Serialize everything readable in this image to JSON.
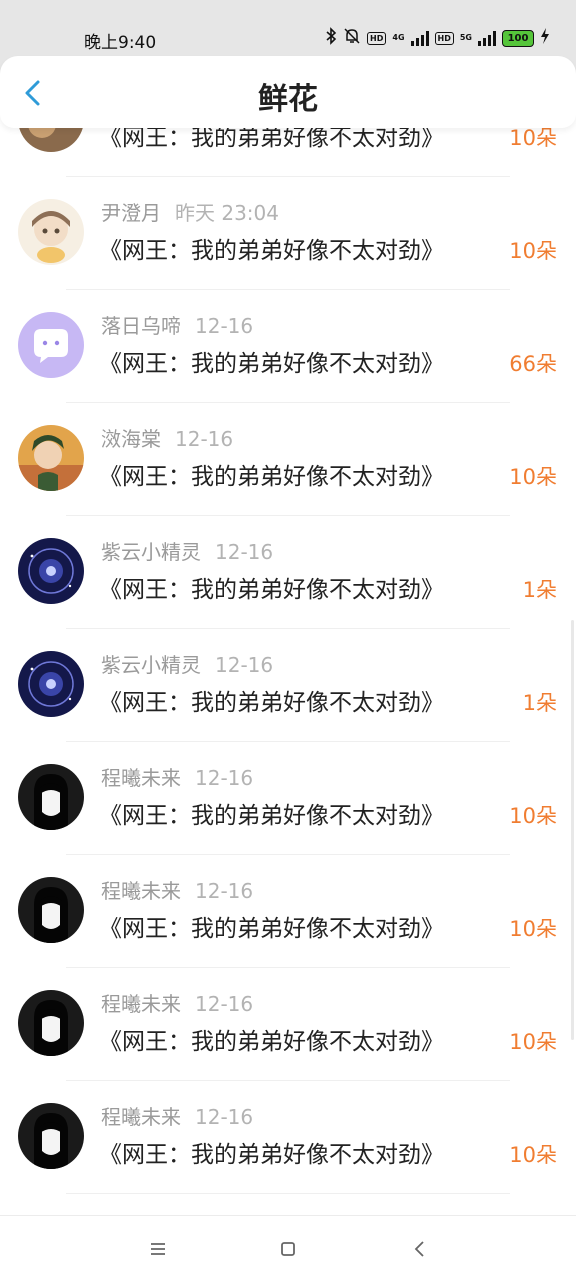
{
  "status_bar": {
    "time": "晚上9:40",
    "hd1": "HD",
    "net1": "4G",
    "hd2": "HD",
    "net2": "5G",
    "battery": "100",
    "icons": [
      "bluetooth-icon",
      "mute-icon",
      "signal-icon",
      "battery-icon",
      "charging-icon"
    ]
  },
  "header": {
    "title": "鲜花",
    "back_icon": "chevron-left-icon"
  },
  "items": [
    {
      "name": "",
      "date": "",
      "book": "《网王：我的弟弟好像不太对劲》",
      "count": "10朵",
      "avatar": "photo"
    },
    {
      "name": "尹澄月",
      "date": "昨天 23:04",
      "book": "《网王：我的弟弟好像不太对劲》",
      "count": "10朵",
      "avatar": "anime-girl"
    },
    {
      "name": "落日乌啼",
      "date": "12-16",
      "book": "《网王：我的弟弟好像不太对劲》",
      "count": "66朵",
      "avatar": "chat-bubble"
    },
    {
      "name": "滧海棠",
      "date": "12-16",
      "book": "《网王：我的弟弟好像不太对劲》",
      "count": "10朵",
      "avatar": "anime-boy"
    },
    {
      "name": "紫云小精灵",
      "date": "12-16",
      "book": "《网王：我的弟弟好像不太对劲》",
      "count": "1朵",
      "avatar": "galaxy"
    },
    {
      "name": "紫云小精灵",
      "date": "12-16",
      "book": "《网王：我的弟弟好像不太对劲》",
      "count": "1朵",
      "avatar": "galaxy"
    },
    {
      "name": "程曦未来",
      "date": "12-16",
      "book": "《网王：我的弟弟好像不太对劲》",
      "count": "10朵",
      "avatar": "bw-girl"
    },
    {
      "name": "程曦未来",
      "date": "12-16",
      "book": "《网王：我的弟弟好像不太对劲》",
      "count": "10朵",
      "avatar": "bw-girl"
    },
    {
      "name": "程曦未来",
      "date": "12-16",
      "book": "《网王：我的弟弟好像不太对劲》",
      "count": "10朵",
      "avatar": "bw-girl"
    },
    {
      "name": "程曦未来",
      "date": "12-16",
      "book": "《网王：我的弟弟好像不太对劲》",
      "count": "10朵",
      "avatar": "bw-girl"
    }
  ],
  "nav_bar": {
    "icons": [
      "menu-icon",
      "home-icon",
      "back-icon"
    ]
  },
  "colors": {
    "accent": "#2f9bd8",
    "count": "#f07d31",
    "status_bg": "#e6e6e6"
  }
}
